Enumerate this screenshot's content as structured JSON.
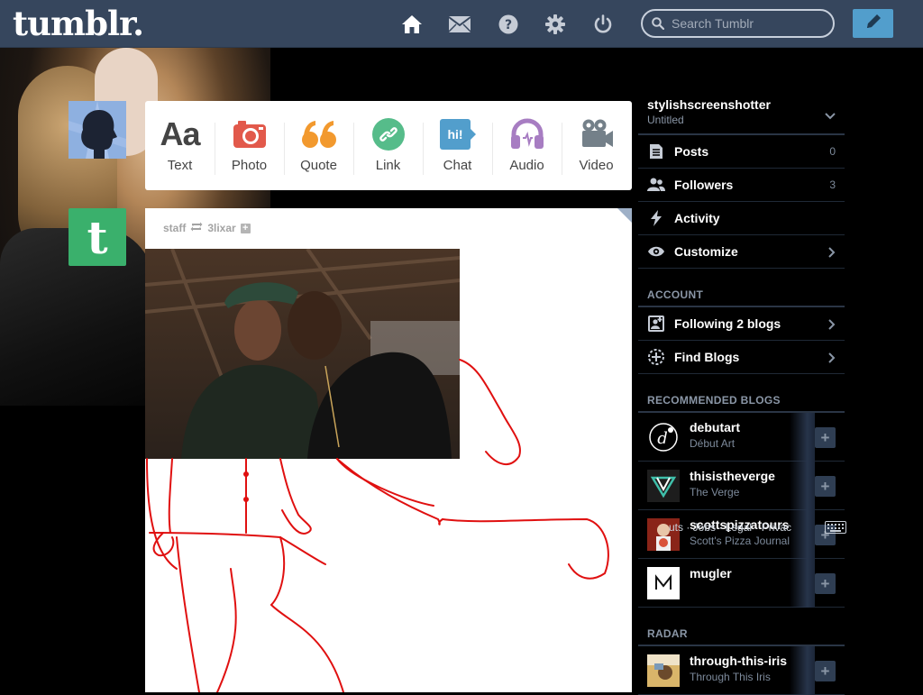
{
  "topbar": {
    "logo": "tumblr.",
    "search_placeholder": "Search Tumblr"
  },
  "post_types": [
    {
      "label": "Text"
    },
    {
      "label": "Photo"
    },
    {
      "label": "Quote"
    },
    {
      "label": "Link"
    },
    {
      "label": "Chat",
      "badge": "hi!"
    },
    {
      "label": "Audio"
    },
    {
      "label": "Video"
    }
  ],
  "post": {
    "author": "staff",
    "reblogged_from": "3lixar"
  },
  "sidebar": {
    "blog_name": "stylishscreenshotter",
    "blog_title": "Untitled",
    "menu": [
      {
        "label": "Posts",
        "count": "0"
      },
      {
        "label": "Followers",
        "count": "3"
      },
      {
        "label": "Activity"
      },
      {
        "label": "Customize"
      }
    ],
    "account_title": "ACCOUNT",
    "account": [
      {
        "label": "Following 2 blogs"
      },
      {
        "label": "Find Blogs"
      }
    ],
    "recommended_title": "RECOMMENDED BLOGS",
    "recommended": [
      {
        "name": "debutart",
        "title": "Début Art"
      },
      {
        "name": "thisistheverge",
        "title": "The Verge"
      },
      {
        "name": "scottspizzatours",
        "title": "Scott's Pizza Journal"
      },
      {
        "name": "mugler",
        "title": ""
      }
    ],
    "overlay_text": "uts · Jobs · Legal · Privac",
    "radar_title": "RADAR",
    "radar": {
      "name": "through-this-iris",
      "title": "Through This Iris"
    }
  },
  "colors": {
    "topbar": "#36465d",
    "compose": "#529ecc",
    "photo_icon": "#e2594b",
    "quote_icon": "#f2992e",
    "link_icon": "#56bc8a",
    "chat_icon": "#529ecc",
    "audio_icon": "#a77dc2",
    "video_icon": "#748089",
    "sketch_line": "#e01010"
  }
}
